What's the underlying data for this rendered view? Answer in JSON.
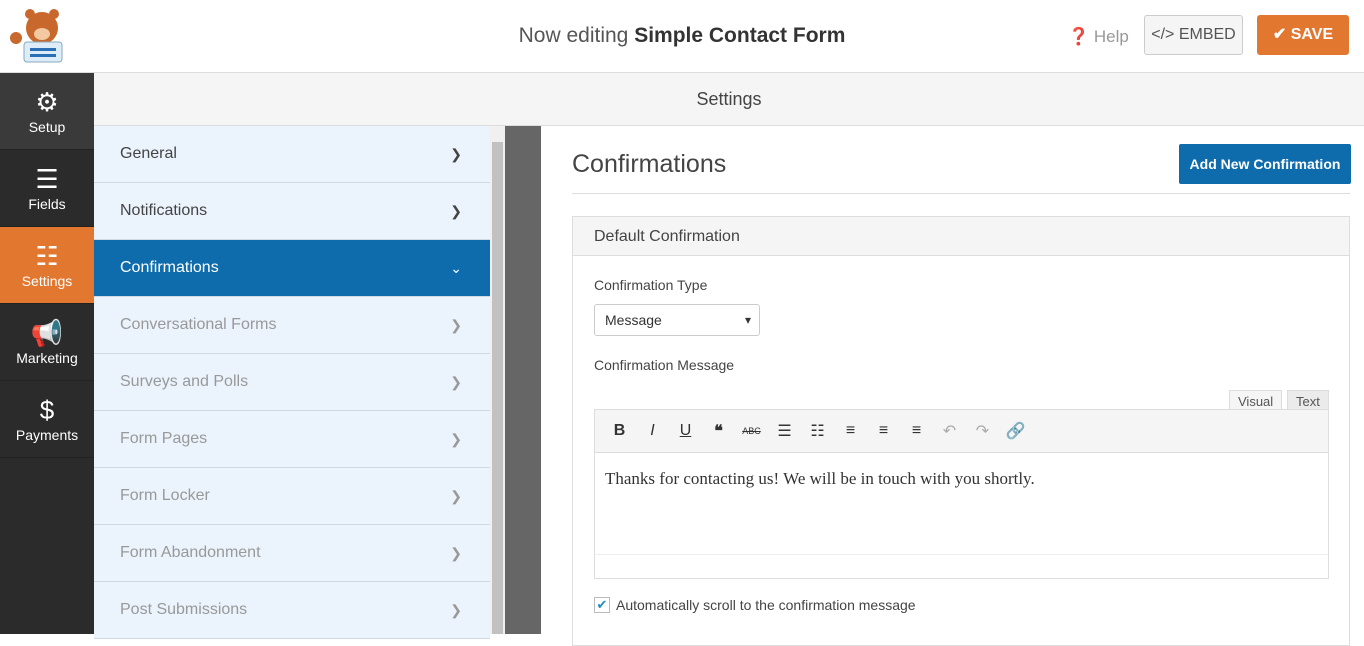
{
  "header": {
    "prefix": "Now editing",
    "form_name": "Simple Contact Form",
    "help": "Help",
    "embed": "</> EMBED",
    "save": "✔ SAVE"
  },
  "sidebar": {
    "items": [
      {
        "label": "Setup",
        "icon": "⚙"
      },
      {
        "label": "Fields",
        "icon": "☰"
      },
      {
        "label": "Settings",
        "icon": "☷"
      },
      {
        "label": "Marketing",
        "icon": "📢"
      },
      {
        "label": "Payments",
        "icon": "$"
      }
    ]
  },
  "settings_title": "Settings",
  "panel": {
    "items": [
      {
        "label": "General"
      },
      {
        "label": "Notifications"
      },
      {
        "label": "Confirmations"
      },
      {
        "label": "Conversational Forms"
      },
      {
        "label": "Surveys and Polls"
      },
      {
        "label": "Form Pages"
      },
      {
        "label": "Form Locker"
      },
      {
        "label": "Form Abandonment"
      },
      {
        "label": "Post Submissions"
      }
    ]
  },
  "main": {
    "title": "Confirmations",
    "add_button": "Add New Confirmation",
    "box_title": "Default Confirmation",
    "type_label": "Confirmation Type",
    "type_value": "Message",
    "message_label": "Confirmation Message",
    "tab_visual": "Visual",
    "tab_text": "Text",
    "message": "Thanks for contacting us! We will be in touch with you shortly.",
    "auto_scroll": "Automatically scroll to the confirmation message",
    "auto_scroll_checked": true
  },
  "colors": {
    "accent": "#e27730",
    "blue": "#0e6cad"
  }
}
